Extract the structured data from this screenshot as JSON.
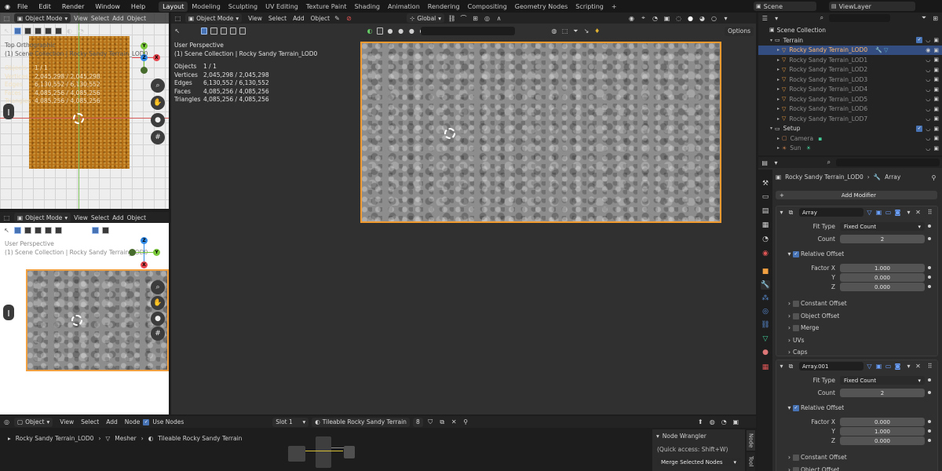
{
  "menu": {
    "items": [
      "File",
      "Edit",
      "Render",
      "Window",
      "Help"
    ],
    "workspaces": [
      "Layout",
      "Modeling",
      "Sculpting",
      "UV Editing",
      "Texture Paint",
      "Shading",
      "Animation",
      "Rendering",
      "Compositing",
      "Geometry Nodes",
      "Scripting"
    ],
    "active_workspace": "Layout",
    "add": "+",
    "scene": "Scene",
    "view_layer": "ViewLayer"
  },
  "vp_top": {
    "mode": "Object Mode",
    "menus": [
      "View",
      "Select",
      "Add",
      "Object"
    ],
    "title": "Top Orthographic",
    "collection": "(1) Scene Collection | Rocky Sandy Terrain_LOD0",
    "stats": {
      "labels": [
        "Objects",
        "Vertices",
        "Edges",
        "Faces",
        "Triangles"
      ],
      "values": [
        "1 / 1",
        "2,045,298 / 2,045,298",
        "6,130,552 / 6,130,552",
        "4,085,256 / 4,085,256",
        "4,085,256 / 4,085,256"
      ]
    }
  },
  "vp_mid": {
    "mode": "Object Mode",
    "menus": [
      "View",
      "Select",
      "Add",
      "Object"
    ],
    "title": "User Perspective",
    "collection": "(1) Scene Collection | Rocky Sandy Terrain_LOD0"
  },
  "vp_main": {
    "mode": "Object Mode",
    "menus": [
      "View",
      "Select",
      "Add",
      "Object"
    ],
    "orientation": "Global",
    "options": "Options",
    "title": "User Perspective",
    "collection": "(1) Scene Collection | Rocky Sandy Terrain_LOD0",
    "stats": {
      "labels": [
        "Objects",
        "Vertices",
        "Edges",
        "Faces",
        "Triangles"
      ],
      "values": [
        "1 / 1",
        "2,045,298 / 2,045,298",
        "6,130,552 / 6,130,552",
        "4,085,256 / 4,085,256",
        "4,085,256 / 4,085,256"
      ]
    }
  },
  "gizmo": {
    "x": "X",
    "y": "Y",
    "z": "Z"
  },
  "node_editor": {
    "mode": "Object",
    "menus": [
      "View",
      "Select",
      "Add",
      "Node"
    ],
    "use_nodes": "Use Nodes",
    "slot": "Slot 1",
    "material": "Tileable Rocky Sandy Terrain",
    "users": "8",
    "breadcrumb": [
      "Rocky Sandy Terrain_LOD0",
      "Mesher",
      "Tileable Rocky Sandy Terrain"
    ],
    "panel_title": "Node Wrangler",
    "panel_hint": "(Quick access: Shift+W)",
    "panel_button": "Merge Selected Nodes",
    "tabs": [
      "Node",
      "Tool"
    ]
  },
  "outliner": {
    "root": "Scene Collection",
    "rows": [
      {
        "label": "Terrain",
        "type": "collection",
        "indent": 1
      },
      {
        "label": "Rocky Sandy Terrain_LOD0",
        "type": "object",
        "indent": 2,
        "selected": true
      },
      {
        "label": "Rocky Sandy Terrain_LOD1",
        "type": "object",
        "indent": 2
      },
      {
        "label": "Rocky Sandy Terrain_LOD2",
        "type": "object",
        "indent": 2
      },
      {
        "label": "Rocky Sandy Terrain_LOD3",
        "type": "object",
        "indent": 2
      },
      {
        "label": "Rocky Sandy Terrain_LOD4",
        "type": "object",
        "indent": 2
      },
      {
        "label": "Rocky Sandy Terrain_LOD5",
        "type": "object",
        "indent": 2
      },
      {
        "label": "Rocky Sandy Terrain_LOD6",
        "type": "object",
        "indent": 2
      },
      {
        "label": "Rocky Sandy Terrain_LOD7",
        "type": "object",
        "indent": 2
      },
      {
        "label": "Setup",
        "type": "collection",
        "indent": 1
      },
      {
        "label": "Camera",
        "type": "camera",
        "indent": 2
      },
      {
        "label": "Sun",
        "type": "light",
        "indent": 2
      }
    ]
  },
  "properties": {
    "object": "Rocky Sandy Terrain_LOD0",
    "modifier_crumb": "Array",
    "add_modifier": "Add Modifier",
    "modifiers": [
      {
        "name": "Array",
        "fit_type_label": "Fit Type",
        "fit_type": "Fixed Count",
        "count_label": "Count",
        "count": "2",
        "relative_offset": "Relative Offset",
        "factor_labels": [
          "Factor X",
          "Y",
          "Z"
        ],
        "factors": [
          "1.000",
          "0.000",
          "0.000"
        ],
        "subpanels": [
          "Constant Offset",
          "Object Offset",
          "Merge",
          "UVs",
          "Caps"
        ]
      },
      {
        "name": "Array.001",
        "fit_type_label": "Fit Type",
        "fit_type": "Fixed Count",
        "count_label": "Count",
        "count": "2",
        "relative_offset": "Relative Offset",
        "factor_labels": [
          "Factor X",
          "Y",
          "Z"
        ],
        "factors": [
          "0.000",
          "1.000",
          "0.000"
        ],
        "subpanels": [
          "Constant Offset",
          "Object Offset"
        ]
      }
    ]
  },
  "colors": {
    "accent": "#4772b3",
    "selection": "#ff9a2e",
    "axis_x": "#e8474f",
    "axis_y": "#79c83a",
    "axis_z": "#2f8ae8"
  }
}
